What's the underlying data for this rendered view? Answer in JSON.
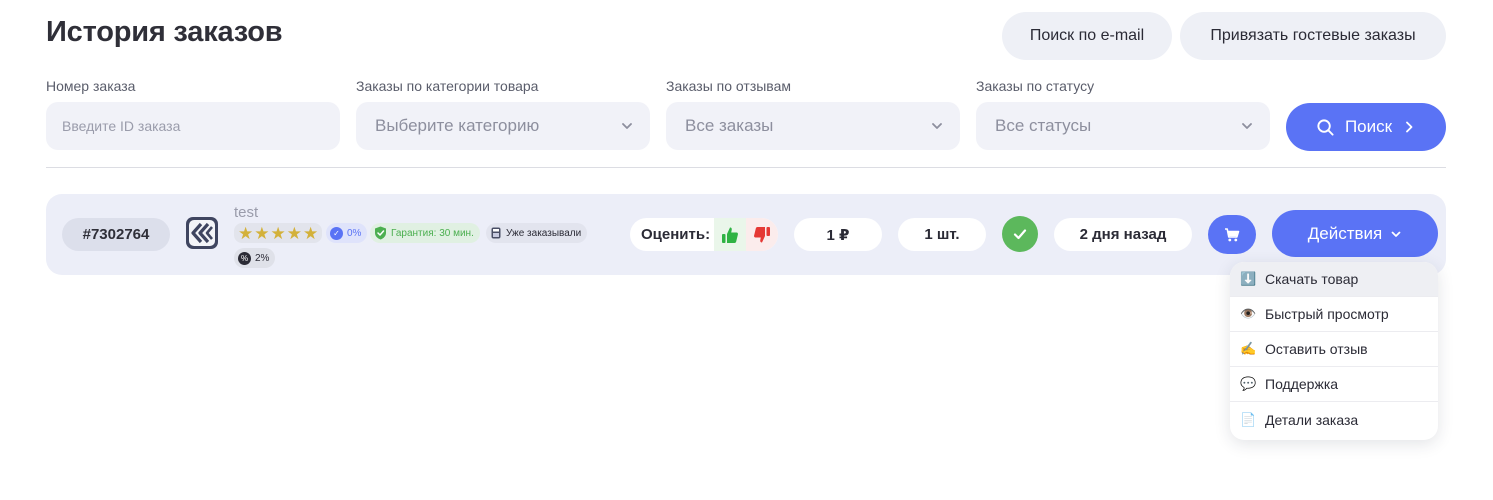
{
  "title": "История заказов",
  "header_buttons": {
    "email_search": "Поиск по e-mail",
    "link_guest": "Привязать гостевые заказы"
  },
  "filters": {
    "order_number": {
      "label": "Номер заказа",
      "placeholder": "Введите ID заказа"
    },
    "category": {
      "label": "Заказы по категории товара",
      "value": "Выберите категорию"
    },
    "reviews": {
      "label": "Заказы по отзывам",
      "value": "Все заказы"
    },
    "status": {
      "label": "Заказы по статусу",
      "value": "Все статусы"
    },
    "search_label": "Поиск"
  },
  "order": {
    "id": "#7302764",
    "product_name": "test",
    "rating_stars": 5,
    "badges": {
      "percent": "0%",
      "guarantee": "Гарантия: 30 мин.",
      "ordered_before": "Уже заказывали",
      "discount": "2%"
    },
    "rate_label": "Оценить:",
    "price": "1 ₽",
    "quantity": "1 шт.",
    "date": "2 дня назад",
    "actions_label": "Действия"
  },
  "actions_menu": [
    {
      "icon": "⬇️",
      "label": "Скачать товар"
    },
    {
      "icon": "👁️",
      "label": "Быстрый просмотр"
    },
    {
      "icon": "✍️",
      "label": "Оставить отзыв"
    },
    {
      "icon": "💬",
      "label": "Поддержка"
    },
    {
      "icon": "📄",
      "label": "Детали заказа"
    }
  ],
  "colors": {
    "accent": "#5a73f5",
    "success": "#5cb85c",
    "star": "#d3b13a",
    "row_bg": "#eceef8"
  }
}
